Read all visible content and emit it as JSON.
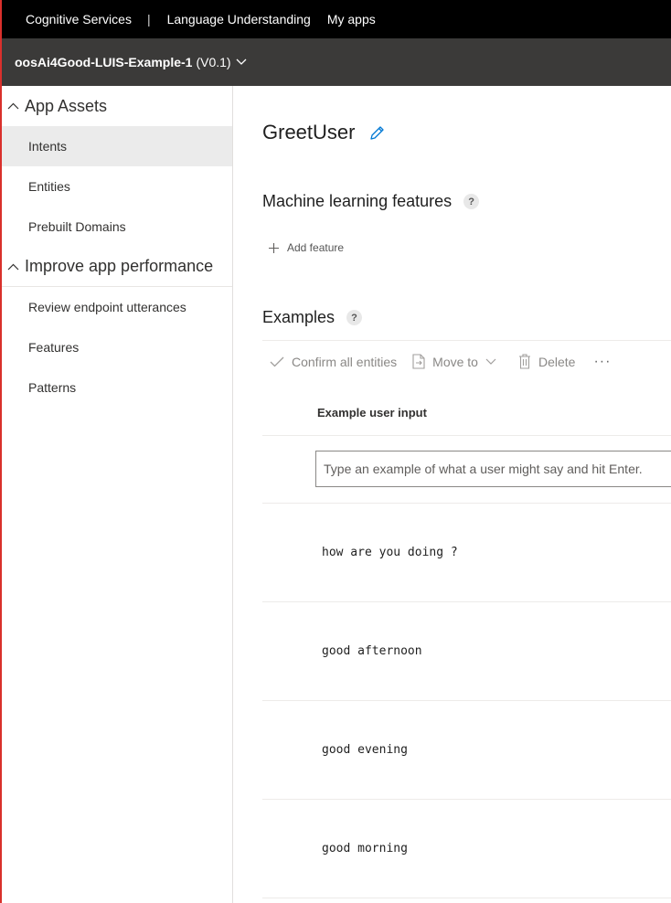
{
  "topnav": {
    "brand": "Cognitive Services",
    "separator": "|",
    "product": "Language Understanding",
    "myapps": "My apps"
  },
  "appbar": {
    "app_name": "oosAi4Good-LUIS-Example-1",
    "version": "(V0.1)"
  },
  "sidebar": {
    "section1": "App Assets",
    "items1": [
      "Intents",
      "Entities",
      "Prebuilt Domains"
    ],
    "section2": "Improve app performance",
    "items2": [
      "Review endpoint utterances",
      "Features",
      "Patterns"
    ]
  },
  "intent": {
    "name": "GreetUser"
  },
  "ml_features": {
    "heading": "Machine learning features",
    "help": "?",
    "add_label": "Add feature"
  },
  "examples": {
    "heading": "Examples",
    "help": "?",
    "toolbar": {
      "confirm": "Confirm all entities",
      "move": "Move to",
      "delete": "Delete",
      "more": "···"
    },
    "column_header": "Example user input",
    "input_placeholder": "Type an example of what a user might say and hit Enter.",
    "utterances": [
      "how are you doing ?",
      "good afternoon",
      "good evening",
      "good morning"
    ]
  },
  "colors": {
    "topbar": "#000000",
    "appbar": "#3b3a39",
    "active_nav_bg": "#ebebeb",
    "accent": "#0078d4",
    "edge_line": "#d9302c"
  }
}
